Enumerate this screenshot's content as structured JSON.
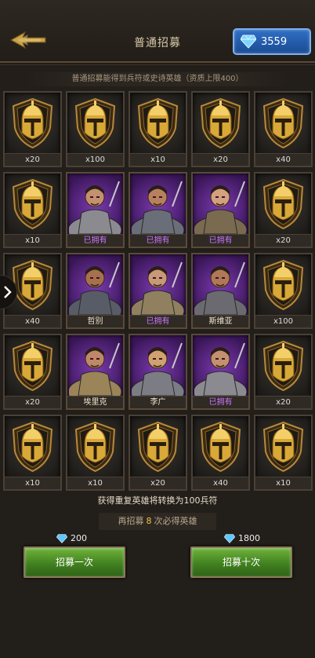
{
  "header": {
    "title": "普通招募",
    "gems": "3559"
  },
  "subtitle": "普通招募能得到兵符或史诗英雄（资质上限400）",
  "grid": [
    {
      "type": "token",
      "label": "x20"
    },
    {
      "type": "token",
      "label": "x100"
    },
    {
      "type": "token",
      "label": "x10"
    },
    {
      "type": "token",
      "label": "x20"
    },
    {
      "type": "token",
      "label": "x40"
    },
    {
      "type": "token",
      "label": "x10"
    },
    {
      "type": "hero",
      "label": "已拥有",
      "owned": true
    },
    {
      "type": "hero",
      "label": "已拥有",
      "owned": true
    },
    {
      "type": "hero",
      "label": "已拥有",
      "owned": true
    },
    {
      "type": "token",
      "label": "x20"
    },
    {
      "type": "token",
      "label": "x40"
    },
    {
      "type": "hero",
      "label": "哲别",
      "owned": false
    },
    {
      "type": "hero",
      "label": "已拥有",
      "owned": true
    },
    {
      "type": "hero",
      "label": "斯维亚",
      "owned": false
    },
    {
      "type": "token",
      "label": "x100"
    },
    {
      "type": "token",
      "label": "x20"
    },
    {
      "type": "hero",
      "label": "埃里克",
      "owned": false
    },
    {
      "type": "hero",
      "label": "李广",
      "owned": false
    },
    {
      "type": "hero",
      "label": "已拥有",
      "owned": true
    },
    {
      "type": "token",
      "label": "x20"
    },
    {
      "type": "token",
      "label": "x10"
    },
    {
      "type": "token",
      "label": "x10"
    },
    {
      "type": "token",
      "label": "x20"
    },
    {
      "type": "token",
      "label": "x40"
    },
    {
      "type": "token",
      "label": "x10"
    }
  ],
  "info": "获得重复英雄将转换为100兵符",
  "guarantee": {
    "prefix": "再招募",
    "count": "8",
    "suffix": "次必得英雄"
  },
  "recruit_one": {
    "cost": "200",
    "label": "招募一次"
  },
  "recruit_ten": {
    "cost": "1800",
    "label": "招募十次"
  },
  "colors": {
    "owned": "#c776ff",
    "button_green": "#4f8f26",
    "gem_blue": "#2f6fc4"
  }
}
